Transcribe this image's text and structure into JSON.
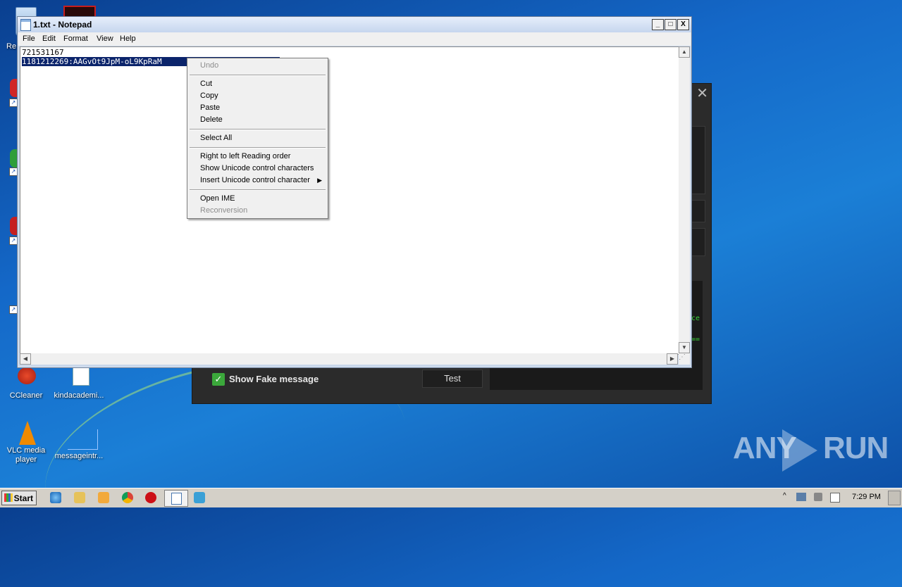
{
  "desktop": {
    "icons": [
      {
        "label": "Re"
      },
      {
        "label": "CCleaner"
      },
      {
        "label": "kindacademi..."
      },
      {
        "label": "VLC media player"
      },
      {
        "label": "messageintr..."
      }
    ]
  },
  "background_app": {
    "show_fake_label": "Show Fake message",
    "test_label": "Test",
    "code_fragments": [
      "ce",
      "=="
    ]
  },
  "notepad": {
    "title": "1.txt - Notepad",
    "menu": [
      "File",
      "Edit",
      "Format",
      "View",
      "Help"
    ],
    "lines": [
      "721531167",
      "1181212269:AAGvOt9JpM-oL9KpRaM"
    ],
    "window_buttons": {
      "minimize": "_",
      "maximize": "□",
      "close": "X"
    }
  },
  "context_menu": {
    "undo": "Undo",
    "cut": "Cut",
    "copy": "Copy",
    "paste": "Paste",
    "delete": "Delete",
    "select_all": "Select All",
    "rtl": "Right to left Reading order",
    "show_unicode": "Show Unicode control characters",
    "insert_unicode": "Insert Unicode control character",
    "open_ime": "Open IME",
    "reconversion": "Reconversion"
  },
  "watermark": {
    "left": "ANY",
    "right": "RUN"
  },
  "taskbar": {
    "start_label": "Start",
    "clock": "7:29 PM"
  },
  "colors": {
    "selection": "#0b246b",
    "checkbox_green": "#3ba83b",
    "code_green": "#36d236"
  }
}
